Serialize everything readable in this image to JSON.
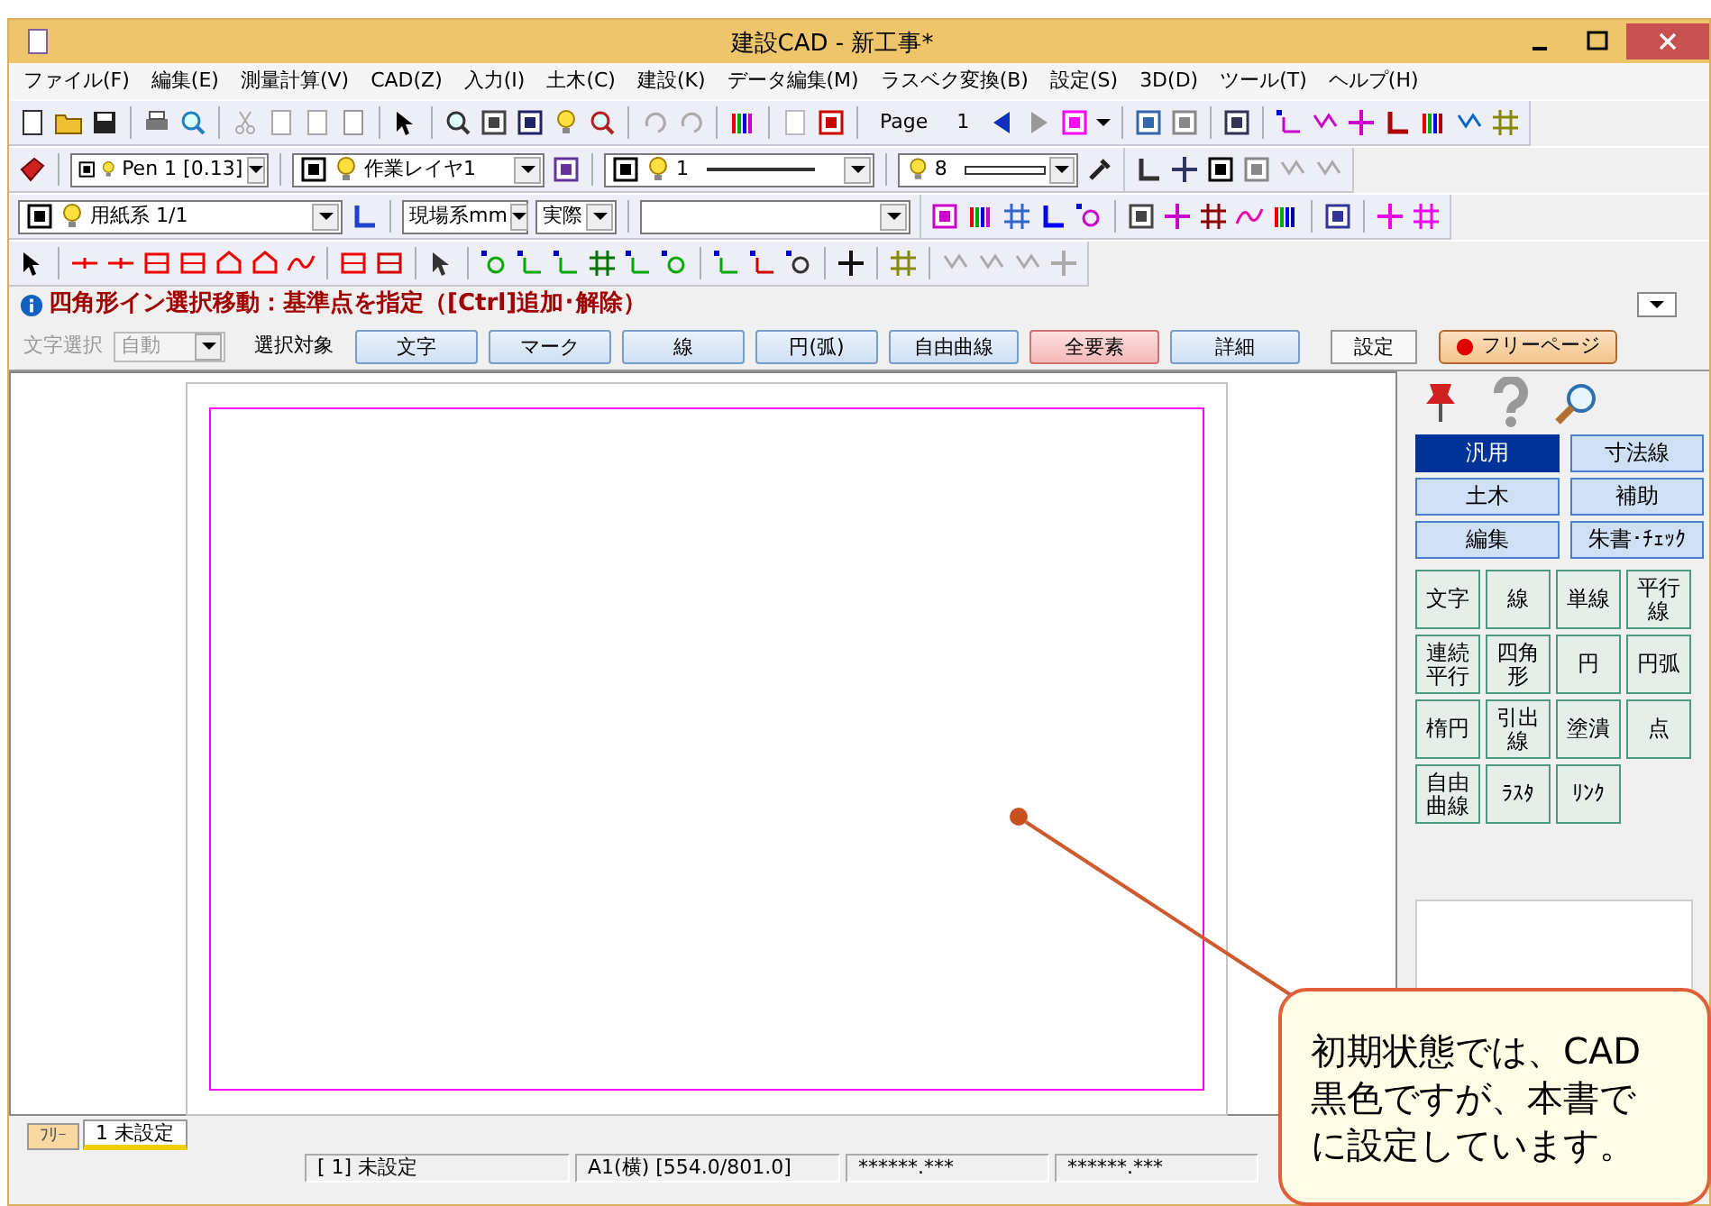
{
  "window": {
    "title": "建設CAD - 新工事*"
  },
  "menu": [
    "ファイル(F)",
    "編集(E)",
    "測量計算(V)",
    "CAD(Z)",
    "入力(I)",
    "土木(C)",
    "建設(K)",
    "データ編集(M)",
    "ラスベク変換(B)",
    "設定(S)",
    "3D(D)",
    "ツール(T)",
    "ヘルプ(H)"
  ],
  "toolbars": [
    [
      {
        "kind": "text",
        "text": "Page"
      },
      {
        "kind": "text",
        "text": "1"
      }
    ],
    [
      {
        "kind": "combo",
        "value": "Pen 1 [0.13]"
      },
      {
        "kind": "combo",
        "value": "作業レイヤ1"
      },
      {
        "kind": "combo",
        "value": "1"
      },
      {
        "kind": "combo",
        "value": "8"
      }
    ],
    [
      {
        "kind": "combo",
        "value": "用紙系 1/1"
      },
      {
        "kind": "combo",
        "value": "現場系mm"
      },
      {
        "kind": "combo",
        "value": "実際"
      },
      {
        "kind": "combo"
      }
    ]
  ],
  "status_message": "四角形イン選択移動：基準点を指定（[Ctrl]追加･解除）",
  "options": {
    "text_select_label": "文字選択",
    "text_select": {
      "value": "自動",
      "disabled": true
    },
    "target_label": "選択対象",
    "targets": [
      {
        "label": "文字",
        "selected": false
      },
      {
        "label": "マーク",
        "selected": false
      },
      {
        "label": "線",
        "selected": false
      },
      {
        "label": "円(弧)",
        "selected": false
      },
      {
        "label": "自由曲線",
        "selected": false
      },
      {
        "label": "全要素",
        "selected": true
      },
      {
        "label": "詳細",
        "selected": false
      }
    ],
    "settings_button": "設定",
    "free_page_button": "フリーページ"
  },
  "categories": [
    {
      "label": "汎用",
      "selected": true
    },
    {
      "label": "寸法線",
      "selected": false
    },
    {
      "label": "土木",
      "selected": false
    },
    {
      "label": "補助",
      "selected": false
    },
    {
      "label": "編集",
      "selected": false
    },
    {
      "label": "朱書･ﾁｪｯｸ",
      "selected": false
    }
  ],
  "tools": [
    "文字",
    "線",
    "単線",
    "平行線",
    "連続平行",
    "四角形",
    "円",
    "円弧",
    "楕円",
    "引出線",
    "塗潰",
    "点",
    "自由曲線",
    "ﾗｽﾀ",
    "ﾘﾝｸ"
  ],
  "page_tabs": [
    {
      "label": "ﾌﾘｰ",
      "selected": false
    },
    {
      "label": "1 未設定",
      "selected": true
    }
  ],
  "status_bar": [
    "[ 1] 未設定",
    "A1(横) [554.0/801.0]",
    "******.***",
    "******.***"
  ],
  "callout": {
    "lines": [
      "初期状態では、CAD",
      "黒色ですが、本書で",
      "に設定しています。"
    ]
  }
}
